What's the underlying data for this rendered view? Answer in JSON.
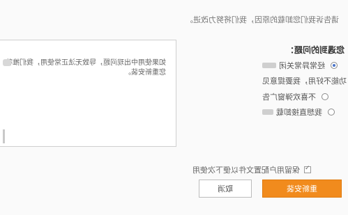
{
  "intro_text": "请告诉我们您卸载的原因，我们将努力改进。",
  "message_text": "如果使用中出现问题，导致无法正常使用，我们推荐您重新安装。",
  "reasons_title": "您遇到的问题：",
  "reasons": [
    {
      "label": "经常异常关闭",
      "checked": true
    },
    {
      "label": "功能不好用，我要提意见",
      "checked": false
    },
    {
      "label": "不喜欢弹窗广告",
      "checked": false
    },
    {
      "label": "我想直接卸载",
      "checked": false
    }
  ],
  "keep_config_label": "保留用户配置文件以便下次使用",
  "keep_config_checked": true,
  "cancel_label": "取消",
  "confirm_label": "重新安装",
  "colors": {
    "accent": "#f18b1d",
    "radio_selected": "#4a74c9"
  }
}
